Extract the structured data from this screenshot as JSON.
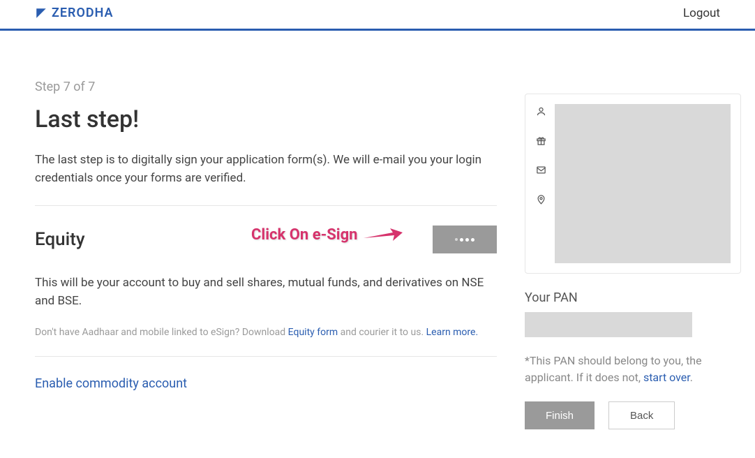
{
  "header": {
    "brand": "ZERODHA",
    "logout": "Logout"
  },
  "main": {
    "step_indicator": "Step 7 of 7",
    "title": "Last step!",
    "subtitle": "The last step is to digitally sign your application form(s). We will e-mail you your login credentials once your forms are verified.",
    "equity": {
      "title": "Equity",
      "desc": "This will be your account to buy and sell shares, mutual funds, and derivatives on NSE and BSE.",
      "help_prefix": "Don't have Aadhaar and mobile linked to eSign? Download ",
      "help_link1": "Equity form",
      "help_mid": " and courier it to us. ",
      "help_link2": "Learn more."
    },
    "enable_commodity": "Enable commodity account",
    "callout_text": "Click On e-Sign"
  },
  "sidebar": {
    "pan_label": "Your PAN",
    "pan_note_prefix": "*This PAN should belong to you, the applicant. If it does not, ",
    "pan_note_link": "start over",
    "pan_note_suffix": ".",
    "finish": "Finish",
    "back": "Back"
  }
}
